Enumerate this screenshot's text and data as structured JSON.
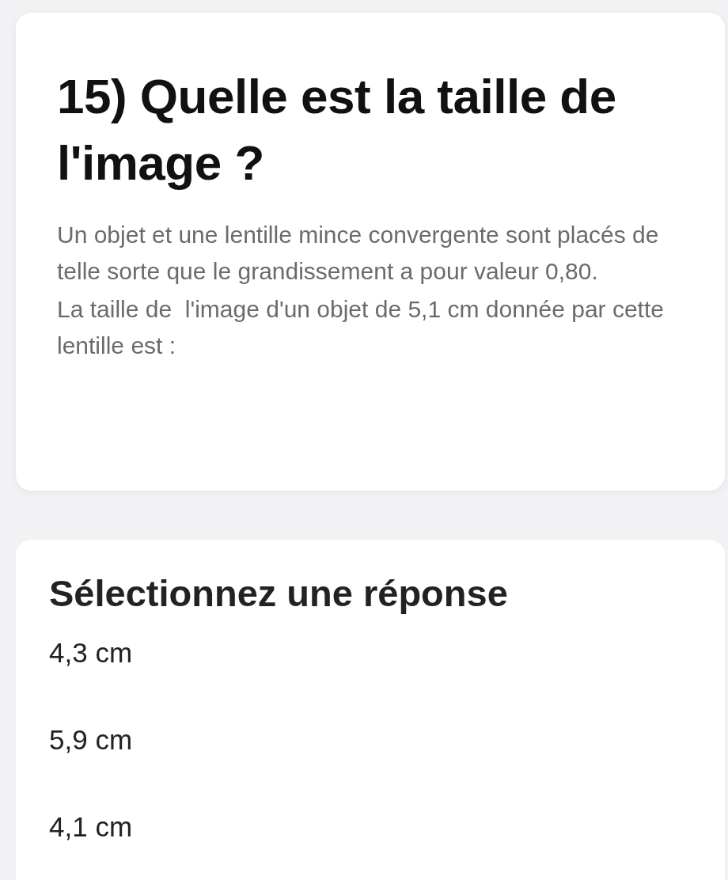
{
  "question": {
    "title": "15) Quelle est la taille de l'image ?",
    "paragraphs": [
      "Un objet et une lentille mince convergente sont placés de telle sorte que le grandissement a pour valeur 0,80.",
      "La taille de  l'image d'un objet de 5,1 cm donnée par cette lentille est :"
    ]
  },
  "answers": {
    "title": "Sélectionnez une réponse",
    "options": [
      "4,3 cm",
      "5,9 cm",
      "4,1 cm"
    ]
  }
}
